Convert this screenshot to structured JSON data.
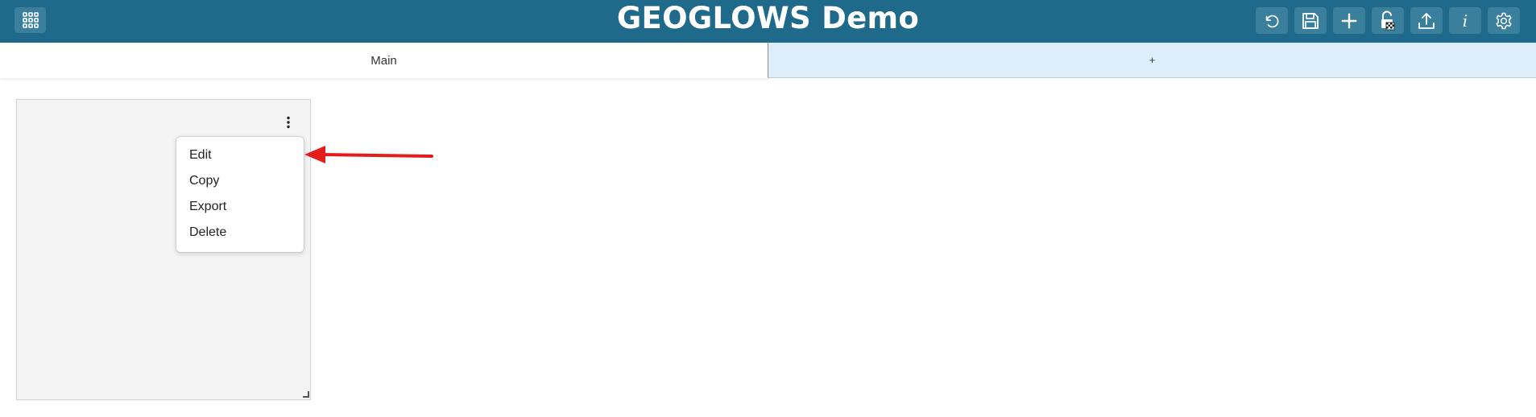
{
  "header": {
    "title": "GEOGLOWS Demo",
    "background": "#1f6a8a",
    "apps_icon": "grid-apps-icon",
    "actions": [
      {
        "name": "reload",
        "icon": "refresh-icon"
      },
      {
        "name": "save",
        "icon": "save-icon"
      },
      {
        "name": "add",
        "icon": "plus-icon"
      },
      {
        "name": "lock",
        "icon": "unlock-icon"
      },
      {
        "name": "export",
        "icon": "upload-icon"
      },
      {
        "name": "info",
        "icon": "info-icon",
        "glyph": "i"
      },
      {
        "name": "settings",
        "icon": "gear-icon"
      }
    ]
  },
  "tabs": {
    "main_label": "Main",
    "add_label": "+",
    "add_tab_color": "#ddeefa"
  },
  "grid_item": {
    "menu_icon": "kebab-menu-icon",
    "menu": {
      "items": [
        "Edit",
        "Copy",
        "Export",
        "Delete"
      ]
    }
  },
  "annotation": {
    "arrow_color": "#e31c1c",
    "points_to": "Edit"
  }
}
